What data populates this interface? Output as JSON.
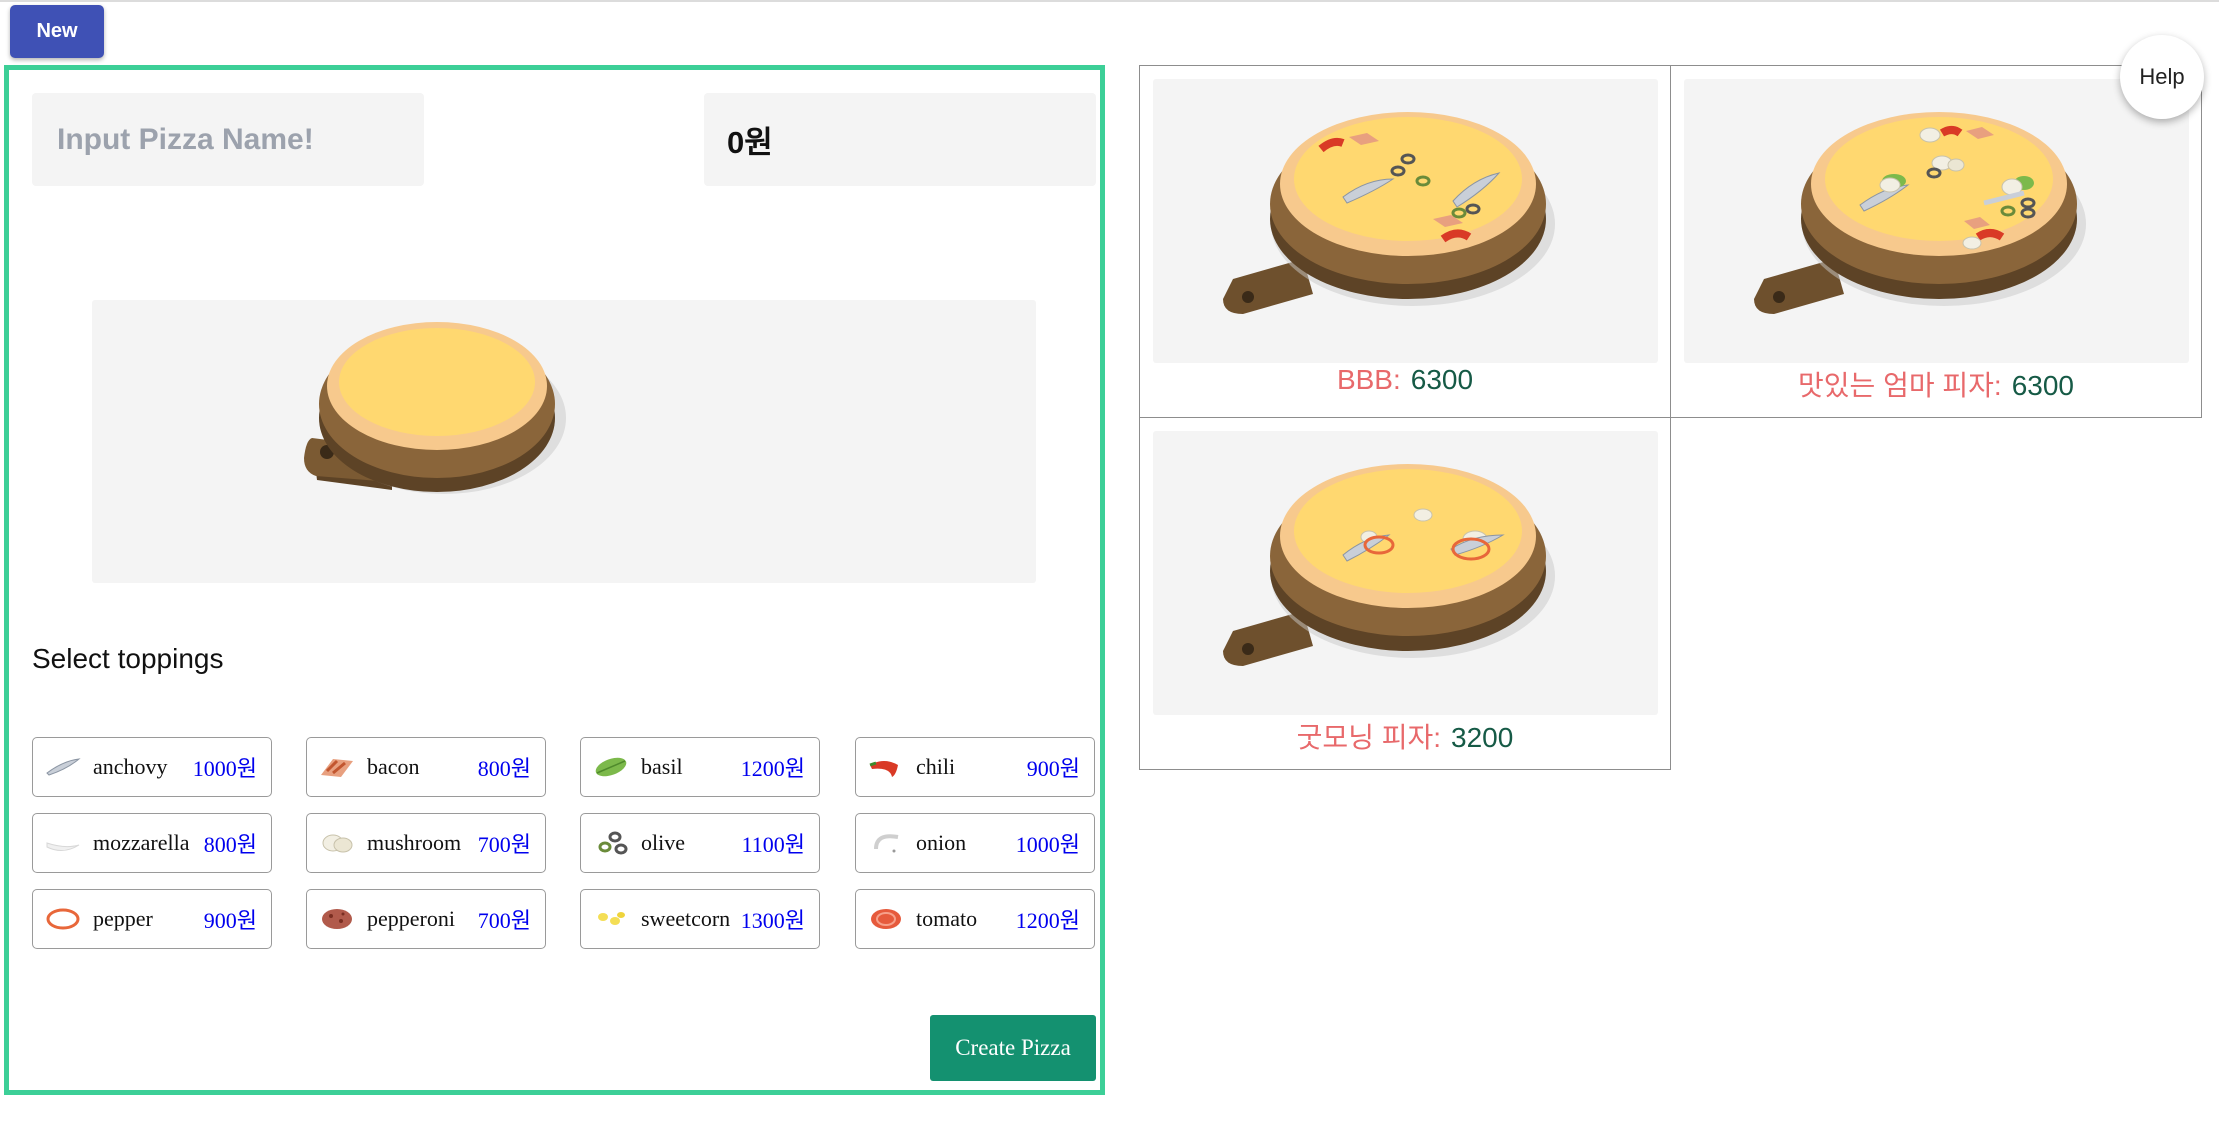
{
  "header": {
    "new_label": "New",
    "help_label": "Help"
  },
  "builder": {
    "name_placeholder": "Input Pizza Name!",
    "name_value": "",
    "total_price": "0원",
    "select_title": "Select toppings",
    "create_label": "Create Pizza",
    "toppings": [
      {
        "name": "anchovy",
        "price": "1000원",
        "icon": "anchovy-icon"
      },
      {
        "name": "bacon",
        "price": "800원",
        "icon": "bacon-icon"
      },
      {
        "name": "basil",
        "price": "1200원",
        "icon": "basil-icon"
      },
      {
        "name": "chili",
        "price": "900원",
        "icon": "chili-icon"
      },
      {
        "name": "mozzarella",
        "price": "800원",
        "icon": "mozzarella-icon"
      },
      {
        "name": "mushroom",
        "price": "700원",
        "icon": "mushroom-icon"
      },
      {
        "name": "olive",
        "price": "1100원",
        "icon": "olive-icon"
      },
      {
        "name": "onion",
        "price": "1000원",
        "icon": "onion-icon"
      },
      {
        "name": "pepper",
        "price": "900원",
        "icon": "pepper-icon"
      },
      {
        "name": "pepperoni",
        "price": "700원",
        "icon": "pepperoni-icon"
      },
      {
        "name": "sweetcorn",
        "price": "1300원",
        "icon": "sweetcorn-icon"
      },
      {
        "name": "tomato",
        "price": "1200원",
        "icon": "tomato-icon"
      }
    ]
  },
  "pizzas": [
    {
      "name": "BBB:",
      "price": "6300"
    },
    {
      "name": "맛있는 엄마 피자:",
      "price": "6300"
    },
    {
      "name": "굿모닝 피자:",
      "price": "3200"
    }
  ],
  "colors": {
    "accent": "#3f51b5",
    "frame": "#3ccf97",
    "create": "#149170",
    "pizza_name": "#e8696b",
    "pizza_price": "#165a46",
    "topping_price": "#0000ee"
  }
}
